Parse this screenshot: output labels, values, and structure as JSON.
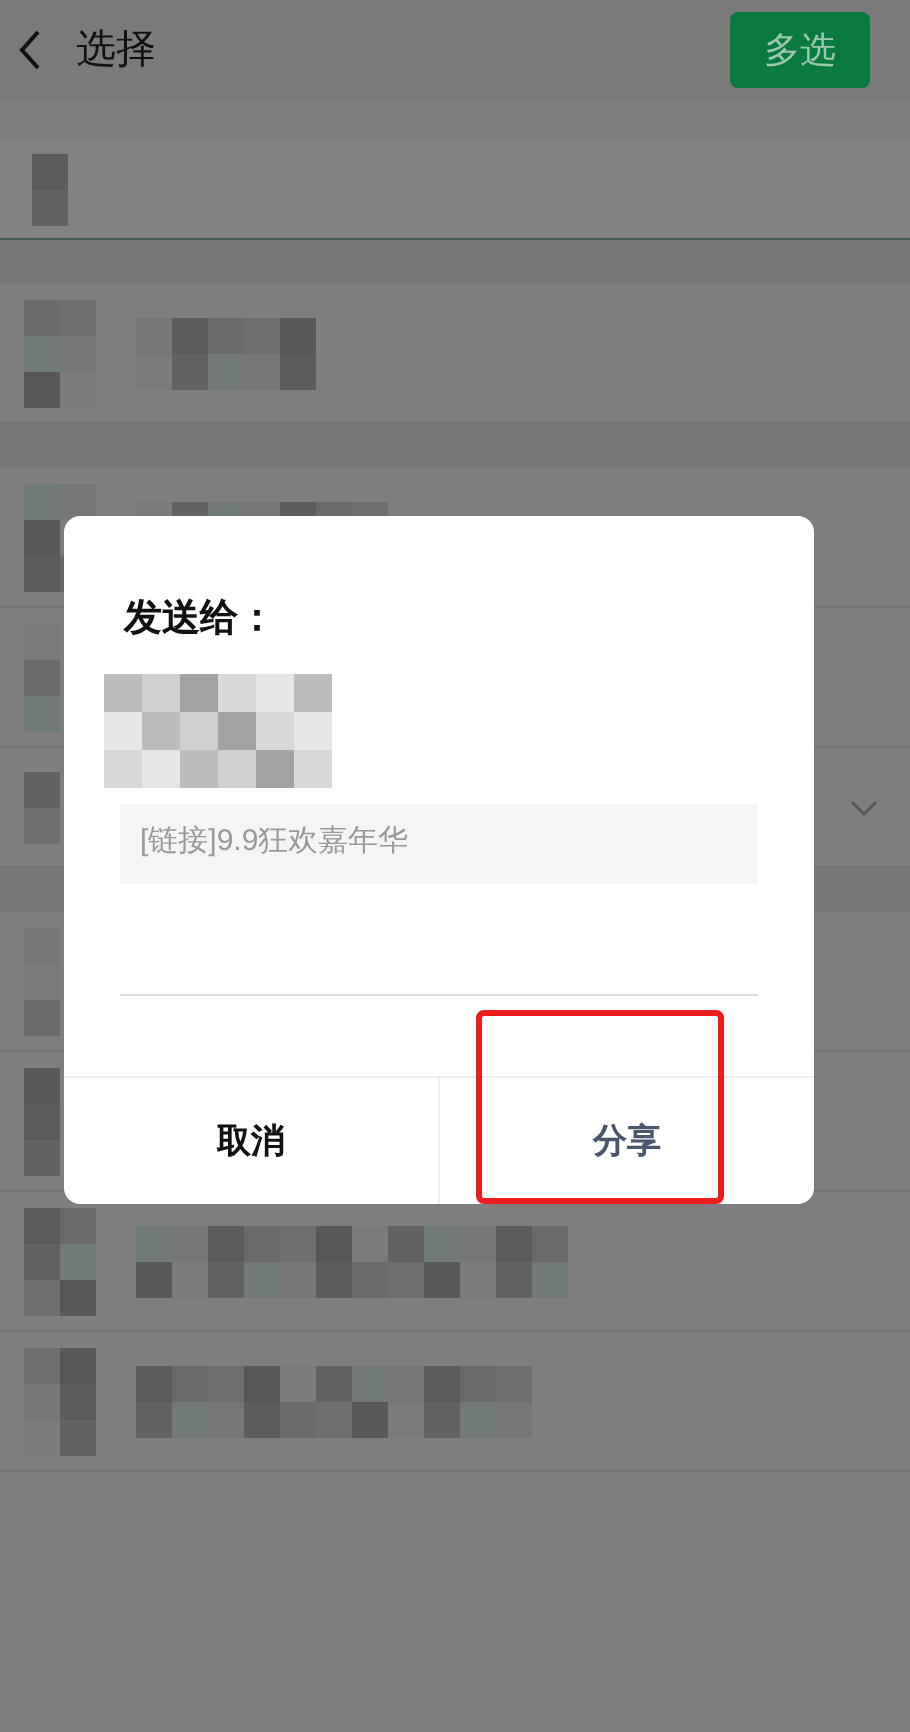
{
  "header": {
    "title": "选择",
    "multi_select_button": "多选"
  },
  "dialog": {
    "title": "发送给：",
    "message": "[链接]9.9狂欢嘉年华",
    "buttons": [
      {
        "label": "取消",
        "kind": "cancel",
        "highlighted": false
      },
      {
        "label": "分享",
        "kind": "confirm",
        "highlighted": true
      }
    ]
  }
}
